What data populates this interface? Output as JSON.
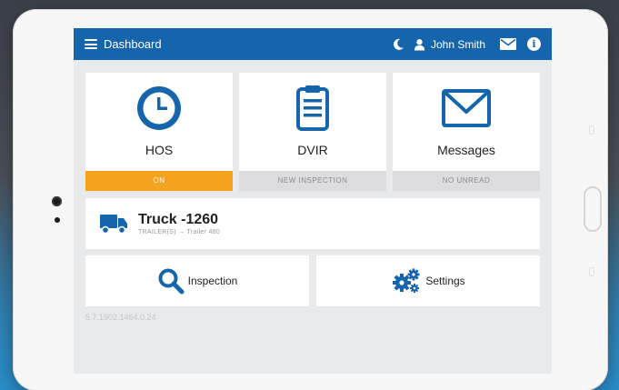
{
  "colors": {
    "brand": "#1565ad",
    "on_status": "#f5a31f"
  },
  "header": {
    "menu_icon": "hamburger-menu-icon",
    "title": "Dashboard",
    "night_mode_icon": "moon-icon",
    "user_icon": "user-icon",
    "user_name": "John Smith",
    "messages_icon": "envelope-icon",
    "info_icon": "info-icon",
    "info_glyph": "i"
  },
  "tiles": [
    {
      "label": "HOS",
      "status": "ON",
      "icon": "clock-icon"
    },
    {
      "label": "DVIR",
      "status": "NEW INSPECTION",
      "icon": "clipboard-icon"
    },
    {
      "label": "Messages",
      "status": "NO UNREAD",
      "icon": "envelope-icon"
    }
  ],
  "vehicle": {
    "icon": "truck-icon",
    "title": "Truck -1260",
    "trailers": "TRAILER(S) → Trailer 480"
  },
  "actions": {
    "inspection_label": "Inspection",
    "inspection_icon": "search-icon",
    "settings_label": "Settings",
    "settings_icon": "gears-icon"
  },
  "version": "5.7.1902.1464.0.24"
}
